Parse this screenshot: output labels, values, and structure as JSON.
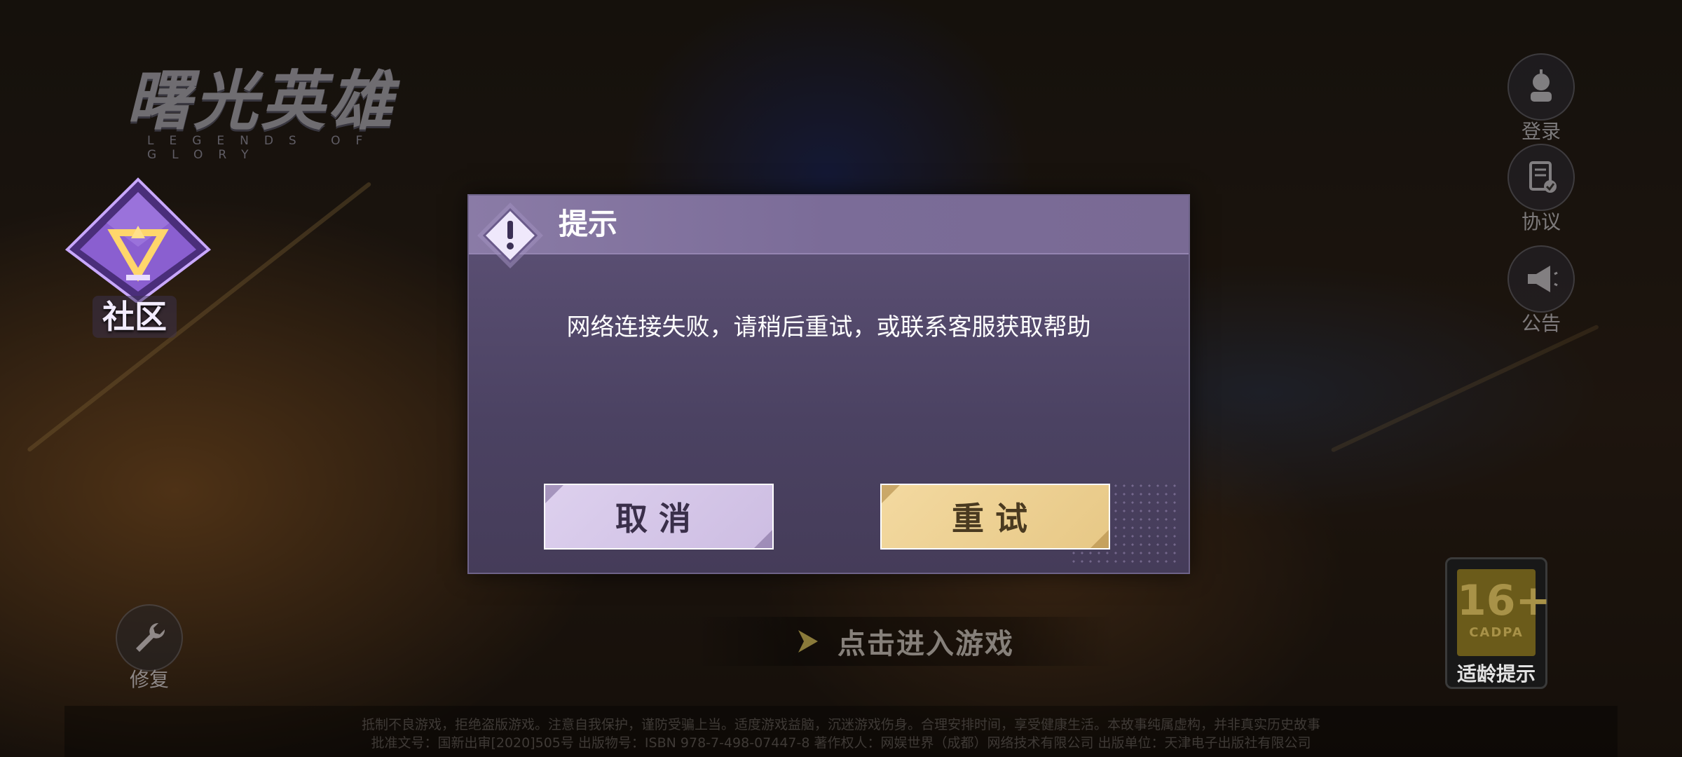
{
  "logo": {
    "title": "曙光英雄",
    "subtitle": "LEGENDS OF GLORY"
  },
  "community": {
    "label": "社区"
  },
  "side_buttons": {
    "login": "登录",
    "agreement": "协议",
    "announcement": "公告"
  },
  "repair": {
    "label": "修复"
  },
  "enter_game": {
    "label": "点击进入游戏"
  },
  "age_rating": {
    "number": "16+",
    "org": "CADPA",
    "tip": "适龄提示"
  },
  "footer": {
    "line1": "抵制不良游戏，拒绝盗版游戏。注意自我保护，谨防受骗上当。适度游戏益脑，沉迷游戏伤身。合理安排时间，享受健康生活。本故事纯属虚构，并非真实历史故事",
    "line2": "批准文号：国新出审[2020]505号  出版物号：ISBN 978-7-498-07447-8  著作权人：网娱世界（成都）网络技术有限公司  出版单位：天津电子出版社有限公司"
  },
  "dialog": {
    "title": "提示",
    "message": "网络连接失败，请稍后重试，或联系客服获取帮助",
    "cancel_label": "取消",
    "retry_label": "重试"
  },
  "colors": {
    "dialog_bg": "#4b4262",
    "dialog_header": "#7b6c98",
    "cancel_bg": "#d6c8ea",
    "retry_bg": "#edd093",
    "community_purple": "#8a5fd0"
  }
}
